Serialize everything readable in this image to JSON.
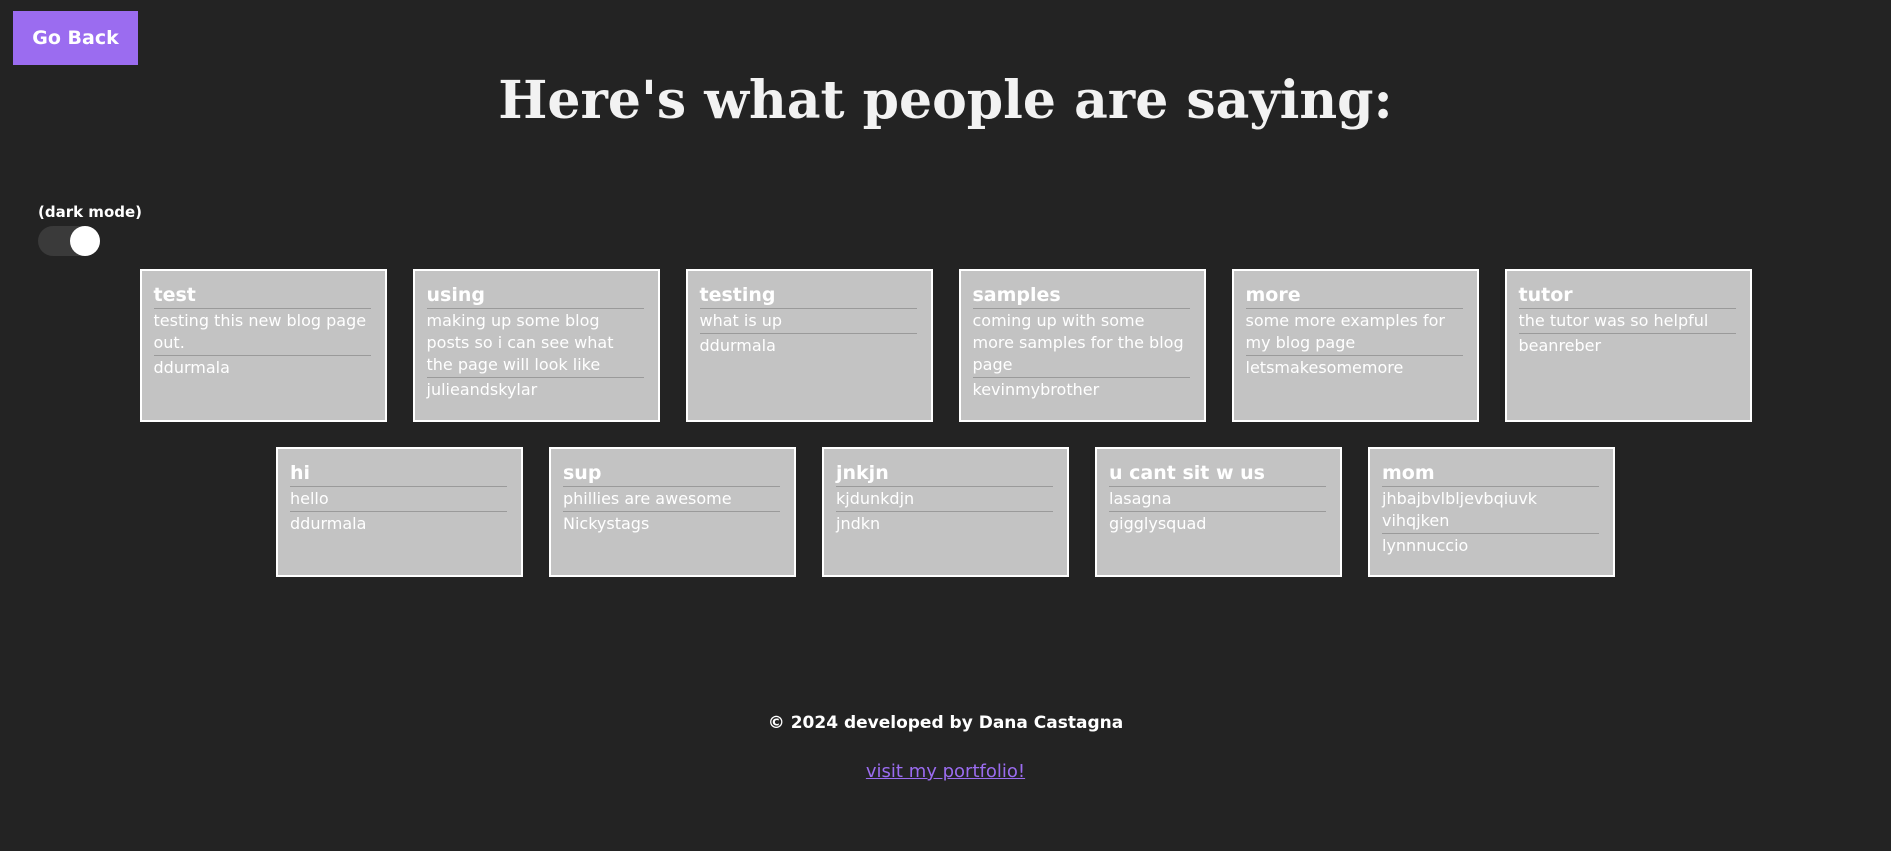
{
  "header": {
    "back_label": "Go Back",
    "title": "Here's what people are saying:"
  },
  "dark_mode": {
    "label": "(dark mode)",
    "enabled": true
  },
  "posts": [
    {
      "title": "test",
      "body": "testing this new blog page out.",
      "author": "ddurmala"
    },
    {
      "title": "using",
      "body": "making up some blog posts so i can see what the page will look like",
      "author": "julieandskylar"
    },
    {
      "title": "testing",
      "body": "what is up",
      "author": "ddurmala"
    },
    {
      "title": "samples",
      "body": "coming up with some more samples for the blog page",
      "author": "kevinmybrother"
    },
    {
      "title": "more",
      "body": "some more examples for my blog page",
      "author": "letsmakesomemore"
    },
    {
      "title": "tutor",
      "body": "the tutor was so helpful",
      "author": "beanreber"
    },
    {
      "title": "hi",
      "body": "hello",
      "author": "ddurmala"
    },
    {
      "title": "sup",
      "body": "phillies are awesome",
      "author": "Nickystags"
    },
    {
      "title": "jnkjn",
      "body": "kjdunkdjn",
      "author": "jndkn"
    },
    {
      "title": "u cant sit w us",
      "body": "lasagna",
      "author": "gigglysquad"
    },
    {
      "title": "mom",
      "body": "jhbajbvlbljevbqiuvk vihqjken",
      "author": "lynnnuccio"
    }
  ],
  "footer": {
    "copyright": "© 2024 developed by Dana Castagna",
    "portfolio_link": "visit my portfolio!"
  },
  "colors": {
    "background": "#232323",
    "accent": "#9b6cf0",
    "card": "#c3c3c3"
  }
}
